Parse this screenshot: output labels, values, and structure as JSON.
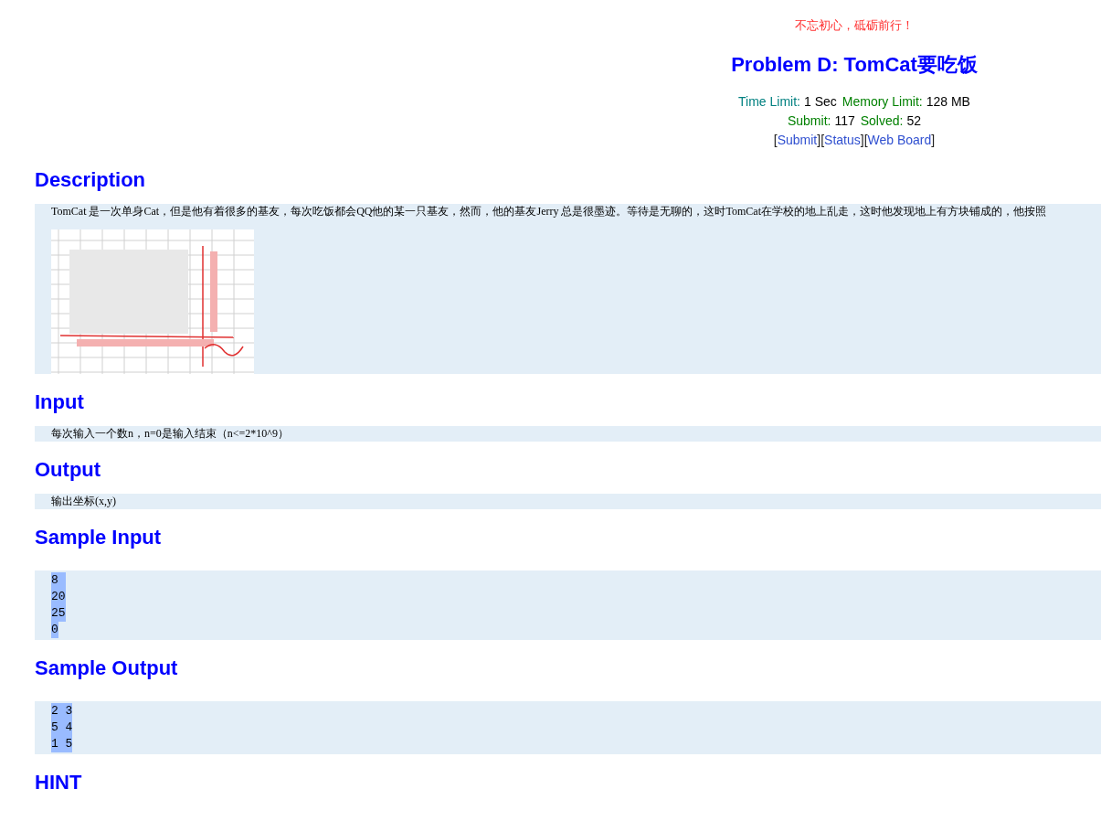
{
  "motto": "不忘初心，砥砺前行！",
  "title": "Problem D: TomCat要吃饭",
  "limits": [
    {
      "label": "Time Limit:",
      "value": "1 Sec",
      "color": "#008080"
    },
    {
      "label": "Memory Limit:",
      "value": "128 MB",
      "color": "#008000"
    }
  ],
  "counts": [
    {
      "label": "Submit:",
      "value": "117",
      "color": "#008000"
    },
    {
      "label": "Solved:",
      "value": "52",
      "color": "#008000"
    }
  ],
  "links": [
    {
      "open": "[",
      "label": "Submit",
      "close": "]"
    },
    {
      "open": "[",
      "label": "Status",
      "close": "]"
    },
    {
      "open": "[",
      "label": "Web Board",
      "close": "]"
    }
  ],
  "sections": [
    {
      "heading": "Description",
      "kind": "text",
      "lines": [
        {
          "text": "TomCat 是一次单身Cat，但是他有着很多的基友，每次吃饭都会QQ他的某一只基友，然而，他的基友Jerry 总是很墨迹。等待是无聊的，这时TomCat在学校的地上乱走，这时他发现地上有方块铺成的，他按照",
          "highlighted": false
        }
      ],
      "picture": {
        "kind": "picture"
      }
    },
    {
      "heading": "Input",
      "kind": "text",
      "lines": [
        {
          "text": "每次输入一个数n，n=0是输入结束（n<=2*10^9）",
          "highlighted": false
        }
      ]
    },
    {
      "heading": "Output",
      "kind": "text",
      "lines": [
        {
          "text": "输出坐标(x,y)",
          "highlighted": false
        }
      ]
    },
    {
      "heading": "Sample Input",
      "kind": "code",
      "lines": [
        {
          "text": "8 ",
          "highlighted": true
        },
        {
          "text": "20",
          "highlighted": true
        },
        {
          "text": "25",
          "highlighted": true
        },
        {
          "text": "0",
          "highlighted": true
        }
      ]
    },
    {
      "heading": "Sample Output",
      "kind": "code",
      "lines": [
        {
          "text": "2 3",
          "highlighted": true
        },
        {
          "text": "5 4",
          "highlighted": true
        },
        {
          "text": "1 5",
          "highlighted": true
        }
      ]
    },
    {
      "heading": "HINT",
      "kind": "empty"
    }
  ]
}
